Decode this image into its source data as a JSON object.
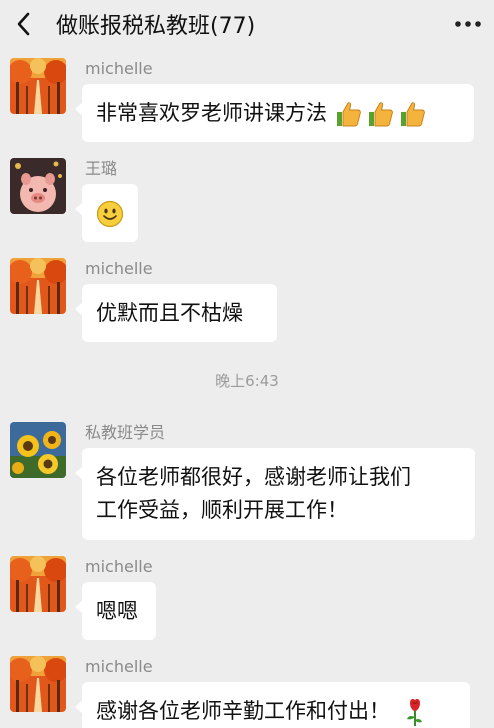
{
  "header": {
    "title": "做账报税私教班(77)",
    "back_icon": "chevron-left-icon",
    "more_icon": "more-dots-icon"
  },
  "messages": [
    {
      "sender": "michelle",
      "text": "非常喜欢罗老师讲课方法",
      "avatar": "autumn-trees-avatar",
      "emoji": [
        "thumbs-up-icon",
        "thumbs-up-icon",
        "thumbs-up-icon"
      ]
    },
    {
      "sender": "王璐",
      "text": "",
      "avatar": "pig-avatar",
      "emoji": [
        "smile-face-icon"
      ]
    },
    {
      "sender": "michelle",
      "text": "优默而且不枯燥",
      "avatar": "autumn-trees-avatar",
      "emoji": []
    },
    {
      "sender": "私教班学员",
      "text": "各位老师都很好，感谢老师让我们\n工作受益，顺利开展工作！",
      "avatar": "sunflower-avatar",
      "emoji": []
    },
    {
      "sender": "michelle",
      "text": "嗯嗯",
      "avatar": "autumn-trees-avatar",
      "emoji": []
    },
    {
      "sender": "michelle",
      "text": "感谢各位老师辛勤工作和付出！",
      "avatar": "autumn-trees-avatar",
      "emoji": [
        "rose-icon"
      ]
    }
  ],
  "timestamp": "晚上6:43",
  "colors": {
    "background": "#ededed",
    "bubble": "#ffffff",
    "sender_text": "#8a8a8a",
    "timestamp_text": "#9b9b9b"
  }
}
